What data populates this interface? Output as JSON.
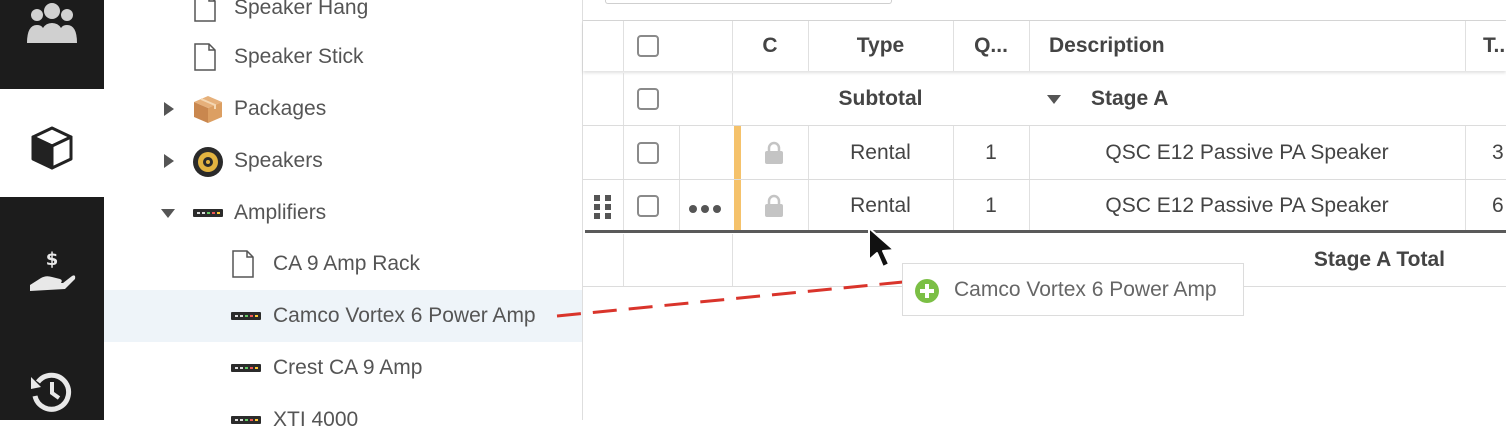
{
  "rail": {
    "icons": [
      "group-icon",
      "box-icon",
      "hand-dollar-icon",
      "history-icon"
    ]
  },
  "tree": {
    "items": [
      {
        "label": "Speaker Hang",
        "icon": "document-icon"
      },
      {
        "label": "Speaker Stick",
        "icon": "document-icon"
      },
      {
        "label": "Packages",
        "icon": "package-box-icon",
        "expander": "collapsed"
      },
      {
        "label": "Speakers",
        "icon": "speaker-icon",
        "expander": "collapsed"
      },
      {
        "label": "Amplifiers",
        "icon": "amplifier-icon",
        "expander": "expanded"
      },
      {
        "label": "CA 9 Amp Rack",
        "icon": "document-icon"
      },
      {
        "label": "Camco Vortex 6 Power Amp",
        "icon": "amplifier-icon",
        "selected": true
      },
      {
        "label": "Crest CA 9 Amp",
        "icon": "amplifier-icon"
      },
      {
        "label": "XTI 4000",
        "icon": "amplifier-icon"
      }
    ]
  },
  "grid": {
    "columns": {
      "c": "C",
      "type": "Type",
      "qty": "Q...",
      "description": "Description",
      "total": "T..."
    },
    "subtotal_row": {
      "type_label": "Subtotal",
      "group_label": "Stage A"
    },
    "rows": [
      {
        "type": "Rental",
        "qty": "1",
        "description": "QSC E12 Passive PA Speaker",
        "total": "3"
      },
      {
        "type": "Rental",
        "qty": "1",
        "description": "QSC E12 Passive PA Speaker",
        "total": "6"
      }
    ],
    "total_row": {
      "label": "Stage A Total"
    }
  },
  "drag": {
    "label": "Camco Vortex 6 Power Amp",
    "line_color": "#d9342b",
    "accent_color": "#7bbf45"
  },
  "colors": {
    "rail_dark": "#1c1c1c",
    "row_marker": "#f5c26b",
    "selected_row": "#eef4f9"
  }
}
